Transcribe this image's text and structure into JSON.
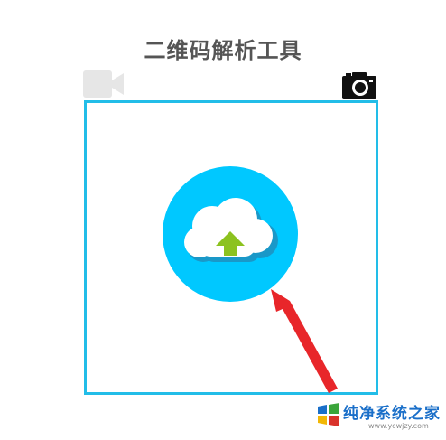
{
  "page": {
    "title": "二维码解析工具"
  },
  "icons": {
    "video": "video-camera-icon",
    "camera": "camera-icon",
    "upload": "cloud-upload-icon",
    "arrow": "red-arrow-annotation"
  },
  "colors": {
    "frame_border": "#22bde8",
    "upload_circle": "#00c8ff",
    "upload_arrow": "#8cc21f",
    "annotation": "#e8262a",
    "title_text": "#555555",
    "video_icon": "#e6e6e6",
    "camera_icon": "#111111"
  },
  "watermark": {
    "text": "纯净系统之家",
    "url": "www.ycwjzy.com"
  }
}
